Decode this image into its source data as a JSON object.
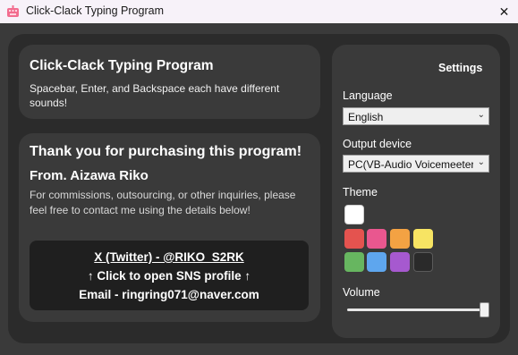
{
  "titlebar": {
    "app_title": "Click-Clack Typing Program",
    "app_icon": "pink-keyboard-icon",
    "close_glyph": "✕"
  },
  "header": {
    "title": "Click-Clack Typing Program",
    "description": "Spacebar, Enter, and Backspace each have different sounds!"
  },
  "thanks": {
    "title": "Thank you for purchasing this program!",
    "from": "From. Aizawa Riko",
    "description": "For commissions, outsourcing, or other inquiries, please feel free to contact me using the details below!",
    "contact": {
      "twitter": "X (Twitter) - @RIKO_S2RK",
      "sns_hint": "↑ Click to open SNS profile ↑",
      "email": "Email - ringring071@naver.com"
    }
  },
  "settings": {
    "title": "Settings",
    "language_label": "Language",
    "language_value": "English",
    "output_label": "Output device",
    "output_value": "PC(VB-Audio Voicemeeter",
    "theme_label": "Theme",
    "theme_colors": {
      "white": "#ffffff",
      "red": "#e4534f",
      "pink": "#e9578f",
      "orange": "#f3a243",
      "yellow": "#f7e463",
      "green": "#67b660",
      "blue": "#5ea6ee",
      "purple": "#a659cf",
      "dark": "#2a2a2a"
    },
    "volume_label": "Volume",
    "volume_level": 1.0
  }
}
